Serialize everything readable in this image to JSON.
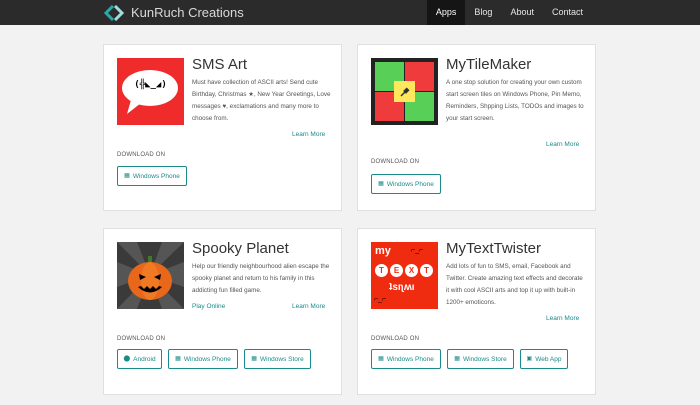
{
  "brand": {
    "name": "KunRuch Creations"
  },
  "nav": [
    "Apps",
    "Blog",
    "About",
    "Contact"
  ],
  "download_label": "DOWNLOAD ON",
  "apps": [
    {
      "title": "SMS Art",
      "description": "Must have collection of ASCII arts! Send cute Birthday, Christmas ★, New Year Greetings, Love messages ♥, exclamations and many more to choose from.",
      "learn_more": "Learn More",
      "buttons": [
        {
          "label": "Windows Phone",
          "icon": "windows-icon"
        }
      ]
    },
    {
      "title": "MyTileMaker",
      "description": "A one stop solution for creating your own custom start screen tiles on Windows Phone, Pin Memo, Reminders, Shpping Lists, TODOs and images to your start screen.",
      "learn_more": "Learn More",
      "buttons": [
        {
          "label": "Windows Phone",
          "icon": "windows-icon"
        }
      ]
    },
    {
      "title": "Spooky Planet",
      "description": "Help our friendly neighbourhood alien escape the spooky planet and return to his family in this addicting fun filled game.",
      "play_online": "Play Online",
      "learn_more": "Learn More",
      "buttons": [
        {
          "label": "Android",
          "icon": "android-icon"
        },
        {
          "label": "Windows Phone",
          "icon": "windows-icon"
        },
        {
          "label": "Windows Store",
          "icon": "windows-icon"
        }
      ]
    },
    {
      "title": "MyTextTwister",
      "description": "Add lots of fun to SMS, email, Facebook and Twitter. Create amazing text effects and decorate it with cool ASCII arts and top it up with built-in 1200+ emoticons.",
      "learn_more": "Learn More",
      "buttons": [
        {
          "label": "Windows Phone",
          "icon": "windows-icon"
        },
        {
          "label": "Windows Store",
          "icon": "windows-icon"
        },
        {
          "label": "Web App",
          "icon": "web-app-icon"
        }
      ]
    }
  ],
  "thumbs": {
    "sms_art_face": "(╬◣_◢)",
    "textwister_top_left": "my",
    "textwister_top_right": "⌐_⌐",
    "textwister_middle": [
      "T",
      "E",
      "X",
      "T"
    ],
    "textwister_bottom": "ʇsıʅʍı",
    "textwister_bottom_left": "⌐_⌐"
  },
  "colors": {
    "accent": "#1a8a8a",
    "navbar": "#2b2b2b",
    "active_nav": "#151515"
  }
}
